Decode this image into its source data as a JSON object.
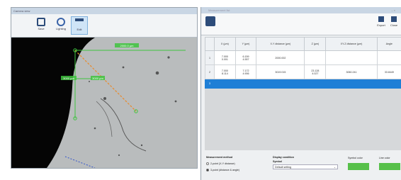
{
  "left_window": {
    "title": "Camera view",
    "tools": [
      "Save",
      "Lighting",
      "Edit"
    ]
  },
  "right_window": {
    "title": "Measurement list",
    "toolbar": {
      "export_label": "Export",
      "other_label": "Close"
    },
    "columns": [
      "X (µm)",
      "Y (µm)",
      "X-Y distance (µm)",
      "Z (µm)",
      "XY-Z distance (µm)",
      "Angle"
    ],
    "rows": [
      {
        "num": "1",
        "x": "7.000\n0.001",
        "y": "6.159\n4.557",
        "xy": "2000.002",
        "z": "",
        "xyz": "",
        "angle": ""
      },
      {
        "num": "2",
        "x": "7.000\n8.114",
        "y": "7.172\n4.906",
        "xy": "3019.015",
        "z": "23.128\n4.027",
        "xyz": "3060.241",
        "angle": "33.8449"
      }
    ],
    "selected_row_num": "3",
    "measurement_method": {
      "label": "Measurement method",
      "options": [
        "2-point (X-Y distance)",
        "3-point (distance & angle)"
      ]
    },
    "display_condition": {
      "label": "Display condition",
      "sub": "Symbol",
      "value": "Default setting"
    },
    "symbol_color_label": "Symbol color",
    "line_color_label": "Line color",
    "colors": {
      "accent": "#57c04a",
      "select": "#1f7fd6"
    }
  },
  "annotations": {
    "top": "2000.0 µm",
    "left": "3000 µm",
    "mid": "3000 µm"
  }
}
